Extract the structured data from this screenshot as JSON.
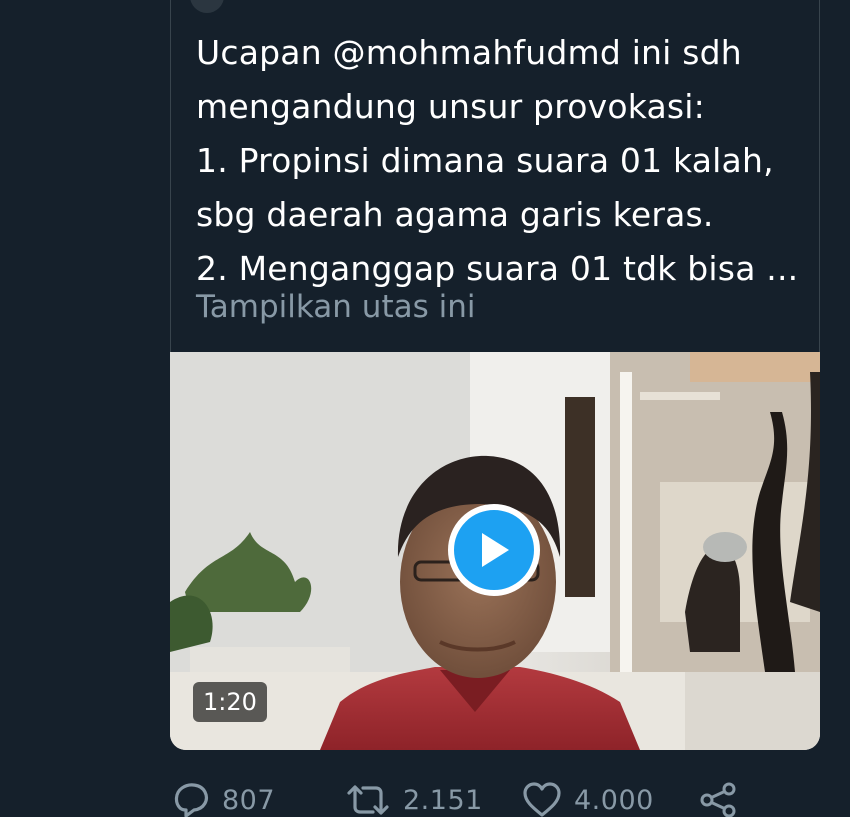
{
  "tweet": {
    "text_lines": [
      "Ucapan @mohmahfudmd ini sdh",
      "mengandung unsur provokasi:",
      "1. Propinsi dimana suara 01 kalah,",
      "sbg daerah agama garis keras.",
      "2. Menganggap suara 01 tdk bisa ..."
    ],
    "show_thread_label": "Tampilkan utas ini"
  },
  "video": {
    "duration": "1:20"
  },
  "actions": {
    "reply_count": "807",
    "retweet_count": "2.151",
    "like_count": "4.000"
  },
  "colors": {
    "background": "#15202b",
    "text_primary": "#ffffff",
    "text_secondary": "#8899a6",
    "accent": "#1da1f2",
    "border": "#38444d"
  },
  "icons": {
    "reply": "reply-icon",
    "retweet": "retweet-icon",
    "like": "like-icon",
    "share": "share-icon",
    "play": "play-icon"
  }
}
